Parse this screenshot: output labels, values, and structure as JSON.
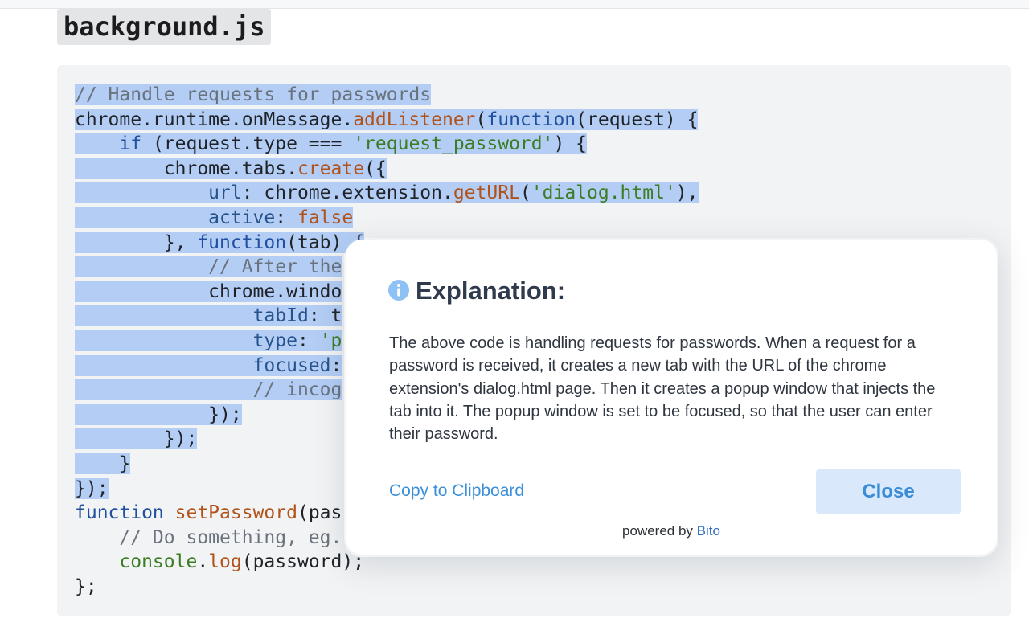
{
  "file": {
    "title": "background.js"
  },
  "code_lines": [
    [
      {
        "t": "// Handle requests for passwords",
        "c": "comment"
      }
    ],
    [
      {
        "t": "chrome.runtime.onMessage.",
        "c": "plain"
      },
      {
        "t": "addListener",
        "c": "func"
      },
      {
        "t": "(",
        "c": "plain"
      },
      {
        "t": "function",
        "c": "keyword"
      },
      {
        "t": "(request) {",
        "c": "plain"
      }
    ],
    [
      {
        "t": "    ",
        "c": "plain"
      },
      {
        "t": "if",
        "c": "keyword"
      },
      {
        "t": " (request.type === ",
        "c": "plain"
      },
      {
        "t": "'request_password'",
        "c": "string"
      },
      {
        "t": ") {",
        "c": "plain"
      }
    ],
    [
      {
        "t": "        chrome.tabs.",
        "c": "plain"
      },
      {
        "t": "create",
        "c": "func"
      },
      {
        "t": "({",
        "c": "plain"
      }
    ],
    [
      {
        "t": "            ",
        "c": "plain"
      },
      {
        "t": "url",
        "c": "prop"
      },
      {
        "t": ": chrome.extension.",
        "c": "plain"
      },
      {
        "t": "getURL",
        "c": "func"
      },
      {
        "t": "(",
        "c": "plain"
      },
      {
        "t": "'dialog.html'",
        "c": "string"
      },
      {
        "t": "),",
        "c": "plain"
      }
    ],
    [
      {
        "t": "            ",
        "c": "plain"
      },
      {
        "t": "active",
        "c": "prop"
      },
      {
        "t": ": ",
        "c": "plain"
      },
      {
        "t": "false",
        "c": "func"
      }
    ],
    [
      {
        "t": "        }, ",
        "c": "plain"
      },
      {
        "t": "function",
        "c": "keyword"
      },
      {
        "t": "(tab) {",
        "c": "plain"
      }
    ],
    [
      {
        "t": "            ",
        "c": "plain"
      },
      {
        "t": "// After the",
        "c": "comment"
      }
    ],
    [
      {
        "t": "            chrome.windo",
        "c": "plain"
      }
    ],
    [
      {
        "t": "                ",
        "c": "plain"
      },
      {
        "t": "tabId",
        "c": "prop"
      },
      {
        "t": ": t",
        "c": "plain"
      }
    ],
    [
      {
        "t": "                ",
        "c": "plain"
      },
      {
        "t": "type",
        "c": "prop"
      },
      {
        "t": ": ",
        "c": "plain"
      },
      {
        "t": "'p",
        "c": "string"
      }
    ],
    [
      {
        "t": "                ",
        "c": "plain"
      },
      {
        "t": "focused",
        "c": "prop"
      },
      {
        "t": ":",
        "c": "plain"
      }
    ],
    [
      {
        "t": "                ",
        "c": "plain"
      },
      {
        "t": "// incog",
        "c": "comment"
      }
    ],
    [
      {
        "t": "            });",
        "c": "plain"
      }
    ],
    [
      {
        "t": "        });",
        "c": "plain"
      }
    ],
    [
      {
        "t": "    }",
        "c": "plain"
      }
    ],
    [
      {
        "t": "});",
        "c": "plain"
      }
    ],
    [
      {
        "t": "function",
        "c": "keyword"
      },
      {
        "t": " ",
        "c": "plain"
      },
      {
        "t": "setPassword",
        "c": "func"
      },
      {
        "t": "(pas",
        "c": "plain"
      }
    ],
    [
      {
        "t": "    ",
        "c": "plain"
      },
      {
        "t": "// Do something, eg.",
        "c": "comment"
      }
    ],
    [
      {
        "t": "    ",
        "c": "plain"
      },
      {
        "t": "console",
        "c": "string"
      },
      {
        "t": ".",
        "c": "plain"
      },
      {
        "t": "log",
        "c": "func"
      },
      {
        "t": "(password);",
        "c": "plain"
      }
    ],
    [
      {
        "t": "};",
        "c": "plain"
      }
    ]
  ],
  "selection": {
    "first_line": 0,
    "last_line": 16
  },
  "modal": {
    "title": "Explanation:",
    "body": "The above code is handling requests for passwords. When a request for a password is received, it creates a new tab with the URL of the chrome extension's dialog.html page. Then it creates a popup window that injects the tab into it. The popup window is set to be focused, so that the user can enter their password.",
    "copy_label": "Copy to Clipboard",
    "close_label": "Close",
    "powered_prefix": "powered by",
    "powered_brand": "Bito"
  },
  "colors": {
    "selection": "#b3cdf5",
    "comment": "#6a737d",
    "keyword": "#1f4f9e",
    "function": "#b1521a",
    "string": "#3b7d23",
    "accent": "#3b8fd9"
  },
  "icons": {
    "modal_title": "info-icon"
  }
}
